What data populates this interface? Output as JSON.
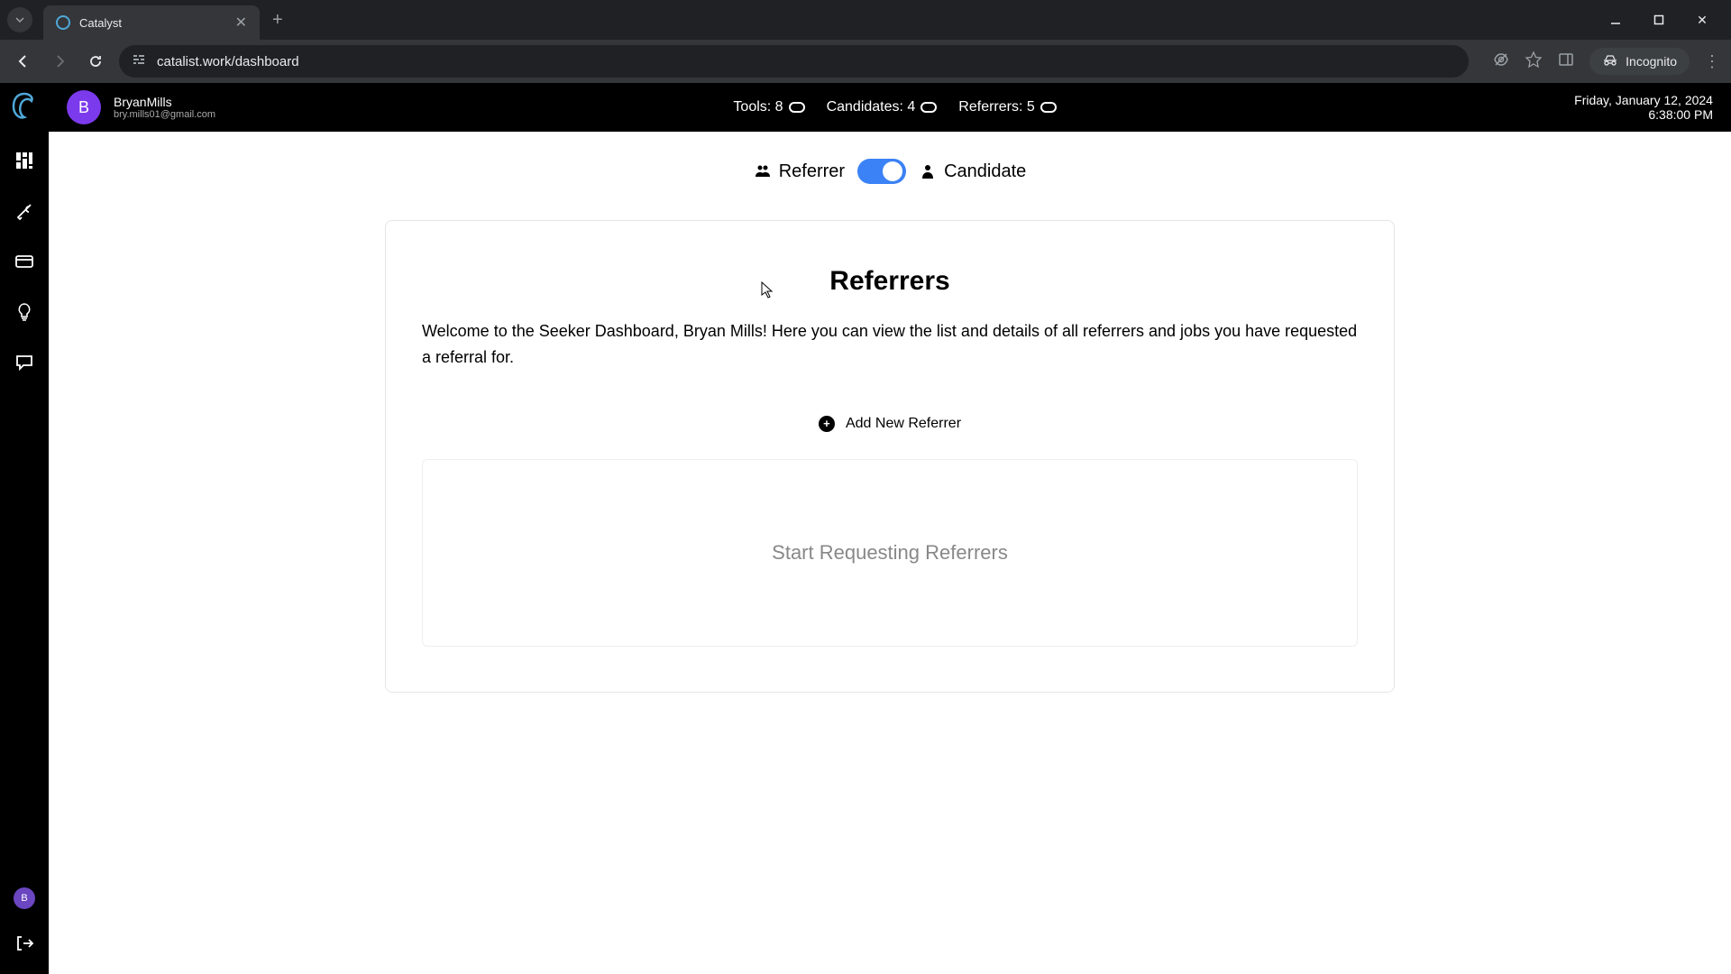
{
  "browser": {
    "tab_title": "Catalyst",
    "url": "catalist.work/dashboard",
    "incognito_label": "Incognito"
  },
  "header": {
    "user_name": "BryanMills",
    "user_email": "bry.mills01@gmail.com",
    "user_initial": "B",
    "stats": {
      "tools_label": "Tools: 8",
      "candidates_label": "Candidates: 4",
      "referrers_label": "Referrers: 5"
    },
    "date": "Friday, January 12, 2024",
    "time": "6:38:00 PM"
  },
  "sidebar": {
    "icons": [
      "dashboard",
      "tools",
      "card",
      "lightbulb",
      "chat"
    ],
    "bottom_initial": "B"
  },
  "toggle": {
    "left_label": "Referrer",
    "right_label": "Candidate"
  },
  "page": {
    "title": "Referrers",
    "welcome": "Welcome to the Seeker Dashboard, Bryan Mills! Here you can view the list and details of all referrers and jobs you have requested a referral for.",
    "add_button": "Add New Referrer",
    "empty_state": "Start Requesting Referrers"
  }
}
